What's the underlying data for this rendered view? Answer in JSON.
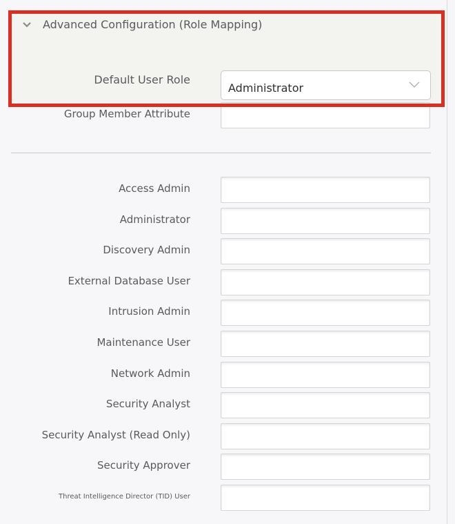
{
  "section": {
    "title": "Advanced Configuration (Role Mapping)",
    "expanded_icon": "chevron-down-icon"
  },
  "default_role": {
    "label": "Default User Role",
    "value": "Administrator"
  },
  "group_member_attribute": {
    "label": "Group Member Attribute",
    "value": ""
  },
  "highlight_color": "#dc2d1e",
  "role_fields": [
    {
      "label": "Access Admin",
      "value": ""
    },
    {
      "label": "Administrator",
      "value": ""
    },
    {
      "label": "Discovery Admin",
      "value": ""
    },
    {
      "label": "External Database User",
      "value": ""
    },
    {
      "label": "Intrusion Admin",
      "value": ""
    },
    {
      "label": "Maintenance User",
      "value": ""
    },
    {
      "label": "Network Admin",
      "value": ""
    },
    {
      "label": "Security Analyst",
      "value": ""
    },
    {
      "label": "Security Analyst (Read Only)",
      "value": ""
    },
    {
      "label": "Security Approver",
      "value": ""
    },
    {
      "label": "Threat Intelligence Director (TID) User",
      "value": ""
    }
  ]
}
